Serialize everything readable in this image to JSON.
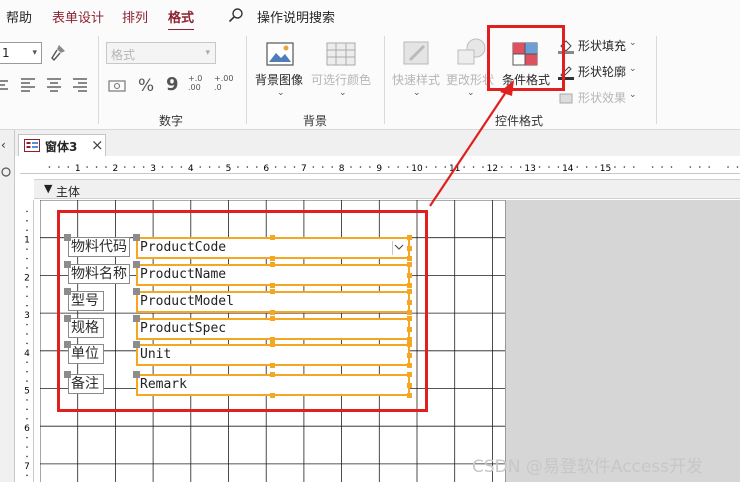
{
  "menu": {
    "tabs": [
      {
        "label": "帮助"
      },
      {
        "label": "表单设计"
      },
      {
        "label": "排列"
      },
      {
        "label": "格式"
      }
    ],
    "active_tab": "格式",
    "search_label": "操作说明搜索"
  },
  "ribbon": {
    "font_size_value": "1",
    "number_format_value": "格式",
    "percent_symbol": "%",
    "comma_symbol": "9",
    "dec_increase": "+.0\n.00",
    "dec_decrease": "+.00\n.0",
    "groups": {
      "number": "数字",
      "background": "背景",
      "control_format": "控件格式"
    },
    "background_image": "背景图像",
    "alt_row_color": "可选行颜色",
    "quick_styles": "快速样式",
    "change_shape": "更改形状",
    "conditional_format": "条件格式",
    "shape_fill": "形状填充",
    "shape_outline": "形状轮廓",
    "shape_effects": "形状效果"
  },
  "document": {
    "tab_title": "窗体3",
    "section_title": "主体"
  },
  "form": {
    "fields": [
      {
        "label": "物料代码",
        "control": "ProductCode"
      },
      {
        "label": "物料名称",
        "control": "ProductName"
      },
      {
        "label": "型号",
        "control": "ProductModel"
      },
      {
        "label": "规格",
        "control": "ProductSpec"
      },
      {
        "label": "单位",
        "control": "Unit"
      },
      {
        "label": "备注",
        "control": "Remark"
      }
    ]
  },
  "ruler": {
    "top_numbers": [
      "1",
      "2",
      "3",
      "4",
      "5",
      "6",
      "7",
      "8",
      "9",
      "10",
      "11",
      "12",
      "13",
      "14",
      "15"
    ],
    "left_numbers": [
      "1",
      "2",
      "3",
      "4",
      "5",
      "6",
      "7"
    ]
  },
  "colors": {
    "accent": "#8c2231",
    "highlight": "#e02020",
    "selection": "#f5a623"
  },
  "watermark": "CSDN @易登软件Access开发"
}
